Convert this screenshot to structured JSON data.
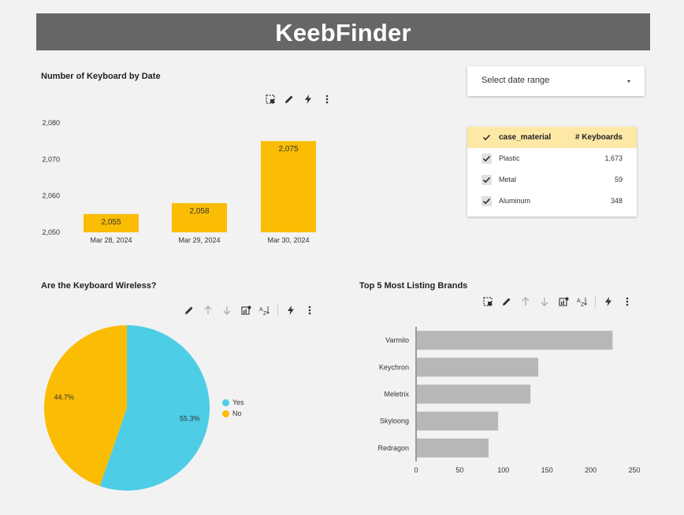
{
  "app": {
    "title": "KeebFinder"
  },
  "colors": {
    "header_bg": "#666666",
    "accent_yellow": "#fbbc04",
    "accent_cyan": "#4ecde6",
    "bar_gray": "#b7b7b7",
    "table_header_bg": "#fde8a6"
  },
  "date_selector": {
    "label": "Select date range"
  },
  "table": {
    "columns": [
      "case_material",
      "# Keyboards"
    ],
    "rows": [
      {
        "material": "Plastic",
        "count": "1,673"
      },
      {
        "material": "Metal",
        "count": "59"
      },
      {
        "material": "Aluminum",
        "count": "348"
      }
    ]
  },
  "toolbar_icons": {
    "date_chart": [
      "select-icon",
      "pencil-icon",
      "lightning-icon",
      "more-vert-icon"
    ],
    "pie_chart": [
      "pencil-icon",
      "arrow-up-icon",
      "arrow-down-icon",
      "chart-settings-icon",
      "sort-az-icon",
      "lightning-icon",
      "more-vert-icon"
    ],
    "brands_chart": [
      "select-icon",
      "pencil-icon",
      "arrow-up-icon",
      "arrow-down-icon",
      "chart-settings-icon",
      "sort-az-icon",
      "lightning-icon",
      "more-vert-icon"
    ]
  },
  "chart_data": [
    {
      "type": "bar",
      "title": "Number of Keyboard by Date",
      "categories": [
        "Mar 28, 2024",
        "Mar 29, 2024",
        "Mar 30, 2024"
      ],
      "values": [
        2055,
        2058,
        2075
      ],
      "data_labels": [
        "2,055",
        "2,058",
        "2,075"
      ],
      "yticks": [
        "2,050",
        "2,060",
        "2,070",
        "2,080"
      ],
      "ytick_values": [
        2050,
        2060,
        2070,
        2080
      ],
      "ylim": [
        2050,
        2080
      ],
      "color": "#fbbc04",
      "grid": false
    },
    {
      "type": "pie",
      "title": "Are the Keyboard Wireless?",
      "labels": [
        "Yes",
        "No"
      ],
      "values": [
        55.3,
        44.7
      ],
      "data_labels": [
        "55.3%",
        "44.7%"
      ],
      "colors": [
        "#4ecde6",
        "#fbbc04"
      ],
      "legend": "right"
    },
    {
      "type": "bar",
      "orientation": "horizontal",
      "title": "Top 5  Most Listing Brands",
      "categories": [
        "Varmilo",
        "Keychron",
        "Meletrix",
        "Skyloong",
        "Redragon"
      ],
      "values": [
        225,
        140,
        131,
        94,
        83
      ],
      "xticks": [
        "0",
        "50",
        "100",
        "150",
        "200",
        "250"
      ],
      "xtick_values": [
        0,
        50,
        100,
        150,
        200,
        250
      ],
      "xlim": [
        0,
        250
      ],
      "color": "#b7b7b7",
      "grid": false
    }
  ]
}
